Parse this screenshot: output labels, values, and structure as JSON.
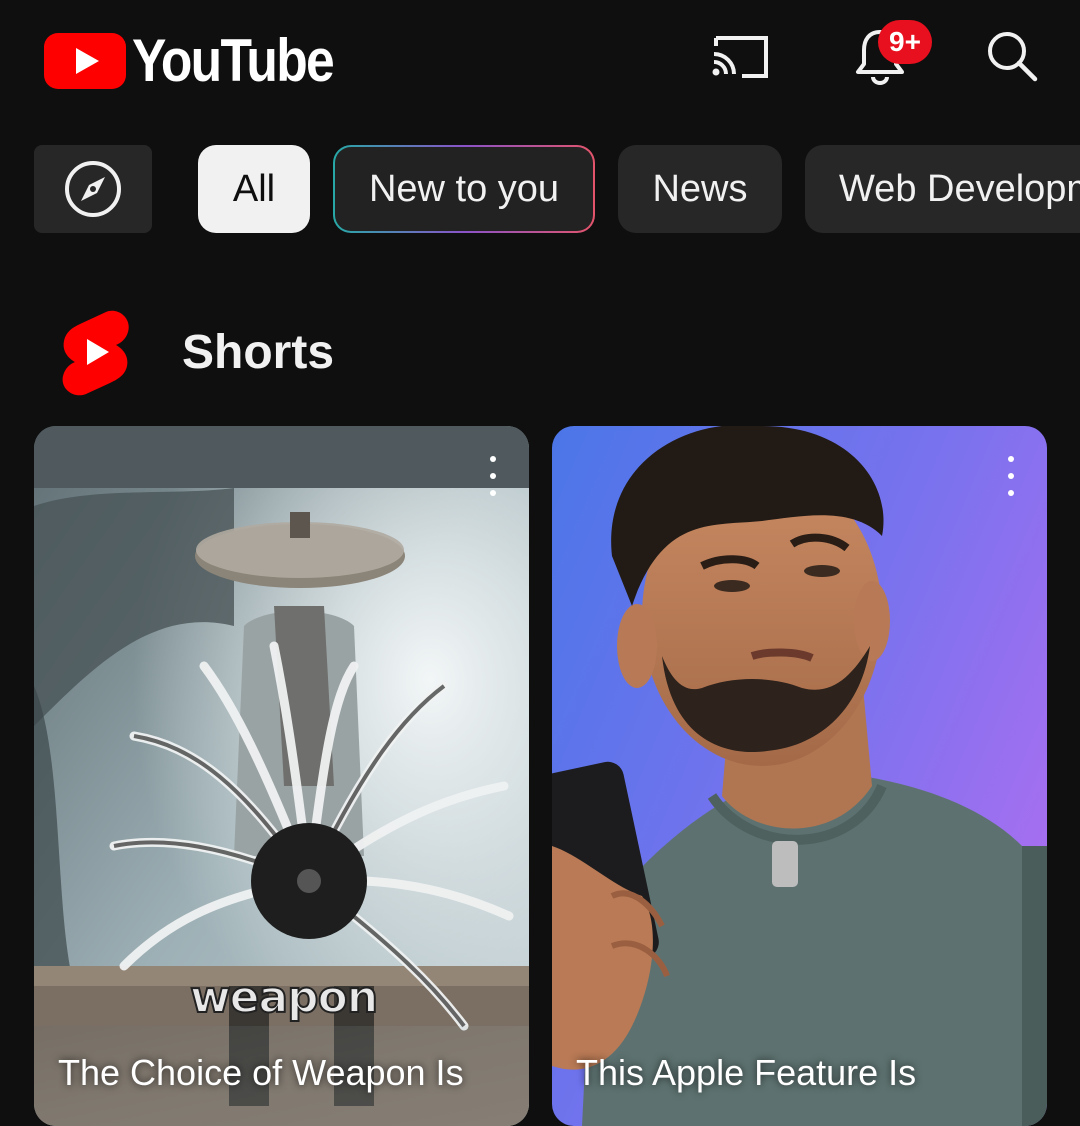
{
  "header": {
    "logo_text": "YouTube",
    "notification_count": "9+",
    "brand_color": "#ff0000",
    "icons": [
      "cast-icon",
      "bell-icon",
      "search-icon"
    ]
  },
  "chips": {
    "explore_icon": "compass-icon",
    "items": [
      {
        "label": "All",
        "selected": true
      },
      {
        "label": "New to you",
        "selected": false
      },
      {
        "label": "News",
        "selected": false
      },
      {
        "label": "Web Developm",
        "selected": false
      }
    ]
  },
  "shorts": {
    "section_title": "Shorts",
    "items": [
      {
        "title": "The Choice of Weapon Is",
        "overlay_text": "weapon"
      },
      {
        "title": "This Apple Feature Is",
        "overlay_text": ""
      }
    ]
  }
}
